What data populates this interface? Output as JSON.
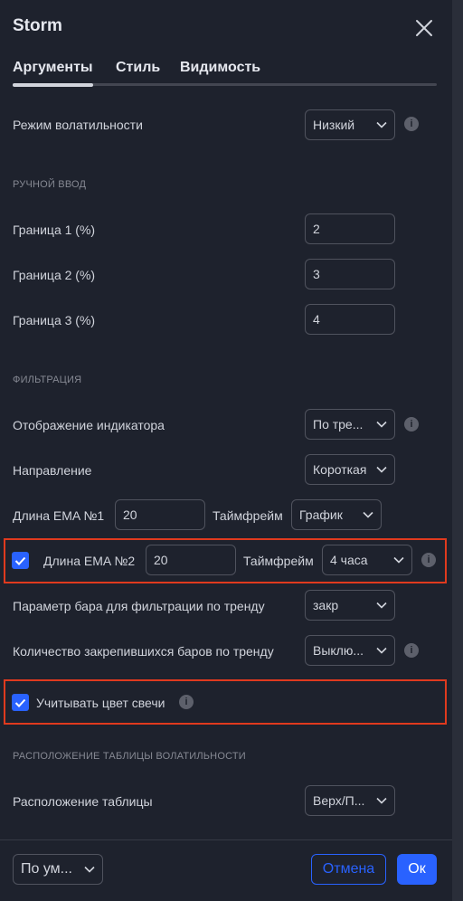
{
  "dialog": {
    "title": "Storm"
  },
  "tabs": [
    {
      "label": "Аргументы",
      "active": true
    },
    {
      "label": "Стиль",
      "active": false
    },
    {
      "label": "Видимость",
      "active": false
    }
  ],
  "volatility": {
    "label": "Режим волатильности",
    "value": "Низкий"
  },
  "manual": {
    "section": "РУЧНОЙ ВВОД",
    "fields": [
      {
        "label": "Граница 1 (%)",
        "value": "2"
      },
      {
        "label": "Граница 2 (%)",
        "value": "3"
      },
      {
        "label": "Граница 3 (%)",
        "value": "4"
      }
    ]
  },
  "filter": {
    "section": "ФИЛЬТРАЦИЯ",
    "indicator_display": {
      "label": "Отображение индикатора",
      "value": "По тре..."
    },
    "direction": {
      "label": "Направление",
      "value": "Короткая"
    },
    "ema1": {
      "label": "Длина EMA №1",
      "value": "20",
      "tf_label": "Таймфрейм",
      "tf_value": "График"
    },
    "ema2": {
      "checked": true,
      "label": "Длина EMA №2",
      "value": "20",
      "tf_label": "Таймфрейм",
      "tf_value": "4 часа"
    },
    "bar_param": {
      "label": "Параметр бара для фильтрации по тренду",
      "value": "закр"
    },
    "bars_count": {
      "label": "Количество закрепившихся баров по тренду",
      "value": "Выклю..."
    },
    "candle_color": {
      "checked": true,
      "label": "Учитывать цвет свечи"
    }
  },
  "table": {
    "section": "РАСПОЛОЖЕНИЕ ТАБЛИЦЫ ВОЛАТИЛЬНОСТИ",
    "label": "Расположение таблицы",
    "value": "Верх/П..."
  },
  "footer": {
    "defaults": "По ум...",
    "cancel": "Отмена",
    "ok": "Ок"
  },
  "colors": {
    "accent": "#2962ff",
    "highlight": "#e03a1e",
    "background": "#1e222d"
  }
}
